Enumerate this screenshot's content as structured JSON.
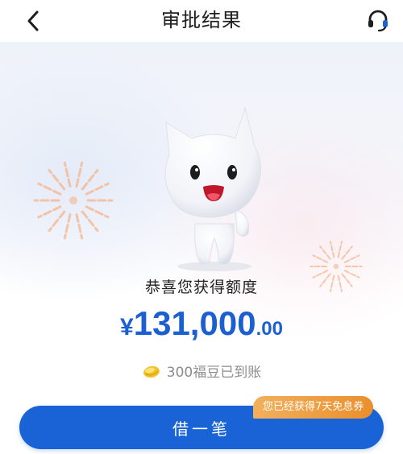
{
  "header": {
    "back_icon": "chevron-left-icon",
    "title": "审批结果",
    "service_icon": "headset-icon"
  },
  "result": {
    "congrats_text": "恭喜您获得额度",
    "amount_currency": "¥",
    "amount_integer": "131,000",
    "amount_decimal": ".00",
    "reward_icon": "gold-bean-icon",
    "reward_text": "300福豆已到账"
  },
  "action": {
    "borrow_label": "借一笔",
    "coupon_badge": "您已经获得7天免息券"
  },
  "colors": {
    "accent_blue": "#1a63d6",
    "amount_blue": "#1b5fd1",
    "badge_orange": "#ee9a3a",
    "firework_orange": "#f6b58c"
  }
}
